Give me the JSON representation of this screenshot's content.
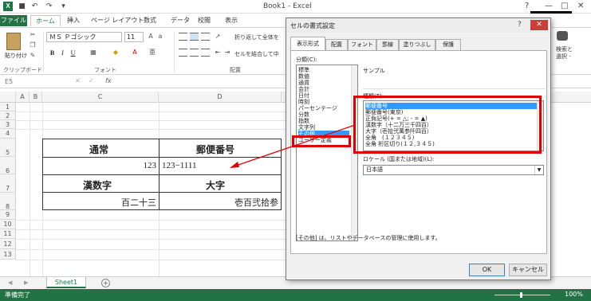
{
  "window": {
    "title": "Book1 - Excel",
    "logo": "X",
    "controls": [
      "?",
      "—",
      "□",
      "✕"
    ]
  },
  "ribbon_tabs": [
    "ファイル",
    "ホーム",
    "挿入",
    "ページ レイアウト",
    "数式",
    "データ",
    "校閲",
    "表示"
  ],
  "ribbon": {
    "paste_label": "貼り付け",
    "clipboard_group": "クリップボード",
    "font_group": "フォント",
    "align_group": "配置",
    "font_name": "ＭＳ Ｐゴシック",
    "font_size": "11",
    "wrap_text": "折り返して全体を",
    "merge_center": "セルを結合して中",
    "find_select": "検索と",
    "find_select2": "選択 -"
  },
  "formula_bar": {
    "namebox": "E5",
    "fx": "fx",
    "cancel": "✕",
    "enter": "✓"
  },
  "sheet": {
    "columns": [
      "A",
      "B",
      "C",
      "D"
    ],
    "rows": [
      "1",
      "2",
      "3",
      "4",
      "5",
      "6",
      "7",
      "8",
      "9",
      "10",
      "11",
      "12",
      "13"
    ],
    "cells": {
      "header1": "通常",
      "header2": "郵便番号",
      "val1": "123",
      "val2": "123−1111",
      "header3": "漢数字",
      "header4": "大字",
      "val3": "百二十三",
      "val4": "壱百弐拾参"
    },
    "tab": "Sheet1",
    "add": "⊕"
  },
  "status": {
    "text": "準備完了",
    "zoom": "100%"
  },
  "dialog": {
    "title": "セルの書式設定",
    "help": "?",
    "close": "✕",
    "tabs": [
      "表示形式",
      "配置",
      "フォント",
      "罫線",
      "塗りつぶし",
      "保護"
    ],
    "category_label": "分類(C):",
    "categories": [
      "標準",
      "数値",
      "通貨",
      "会計",
      "日付",
      "時刻",
      "パーセンテージ",
      "分数",
      "指数",
      "文字列",
      "その他",
      "ユーザー定義"
    ],
    "selected_category": "その他",
    "sample_label": "サンプル",
    "type_label": "種類(T):",
    "types": [
      "郵便番号",
      "郵便番号(東京)",
      "正負記号(+ = △; - = ▲)",
      "漢数字（十二万三千四百）",
      "大字（壱拾弐萬参阡四百）",
      "全角　(１２３４５)",
      "全角 桁区切り(１２,３４５)"
    ],
    "selected_type": "郵便番号",
    "locale_label": "ロケール (国または地域)(L):",
    "locale_value": "日本語",
    "description": "[その他] は、リストやデータベースの管理に使用します。",
    "ok": "OK",
    "cancel": "キャンセル"
  },
  "annotation_color": "#e00000"
}
